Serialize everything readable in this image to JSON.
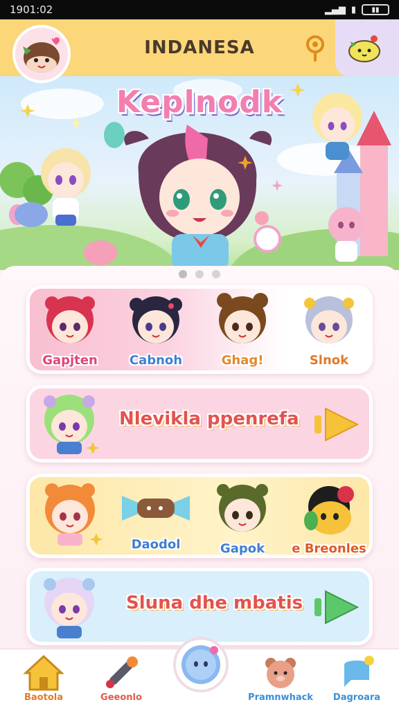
{
  "status_bar": {
    "time": "1901:02",
    "signal": "▂▄▆",
    "battery_icon": "battery-icon"
  },
  "header": {
    "title": "INDANESA",
    "search_icon": "search-icon",
    "mascot_icon": "mascot-icon"
  },
  "hero": {
    "title": "Keplnodk"
  },
  "carousel": {
    "count": 3,
    "active": 0
  },
  "characters_row": {
    "items": [
      {
        "label": "Gapjten",
        "color": "#e0457a"
      },
      {
        "label": "Cabnoh",
        "color": "#3f7fd1"
      },
      {
        "label": "Ghag!",
        "color": "#e08a2a"
      },
      {
        "label": "Slnok",
        "color": "#e07a2a"
      }
    ]
  },
  "feature_row_1": {
    "title": "Nlevikla ppenrefa"
  },
  "items_row": {
    "items": [
      {
        "label": "",
        "color": "#e07a2a"
      },
      {
        "label": "Daodol",
        "color": "#3f7fd1"
      },
      {
        "label": "Gapok",
        "color": "#3f7fd1"
      },
      {
        "label": "e Breonles",
        "color": "#e05a2a"
      }
    ]
  },
  "feature_row_2": {
    "title": "Sluna dhe mbatis"
  },
  "bottom_nav": {
    "items": [
      {
        "label": "Baotola",
        "color": "#e07a2a",
        "icon": "home-icon"
      },
      {
        "label": "Geeonlo",
        "color": "#e05a4a",
        "icon": "paintbrush-icon"
      },
      {
        "label": "Pramnwhack",
        "color": "#3a8fd6",
        "icon": "bear-icon"
      },
      {
        "label": "Dagroara",
        "color": "#3a8fd6",
        "icon": "chat-bubble-icon"
      }
    ],
    "center_icon": "ghost-bubble-icon"
  }
}
